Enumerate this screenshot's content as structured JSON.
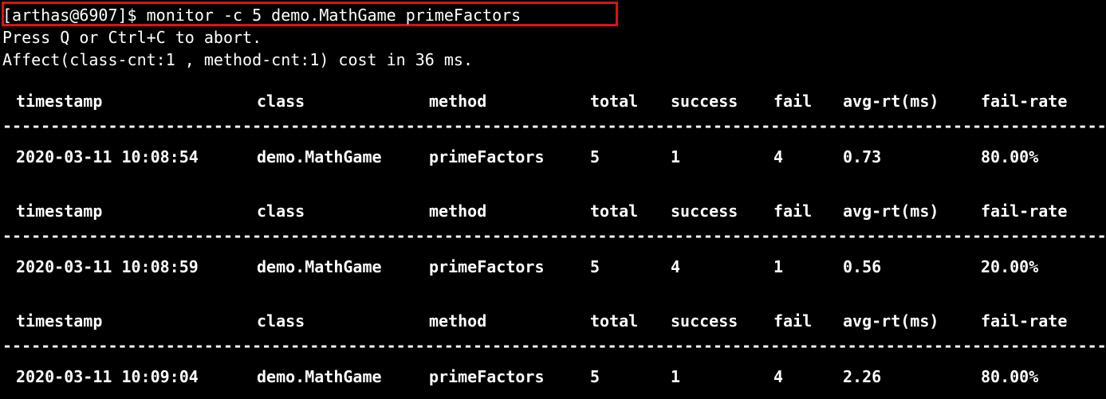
{
  "terminal": {
    "command_line": "[arthas@6907]$ monitor -c 5 demo.MathGame primeFactors",
    "abort_hint": "Press Q or Ctrl+C to abort.",
    "affect_line": "Affect(class-cnt:1 , method-cnt:1) cost in 36 ms.",
    "highlight_color": "#e01010"
  },
  "table": {
    "headers": [
      "timestamp",
      "class",
      "method",
      "total",
      "success",
      "fail",
      "avg-rt(ms)",
      "fail-rate"
    ],
    "separator": "------------------------------------------------------------------------------------------------------------------------------------------------",
    "blocks": [
      {
        "row": [
          "2020-03-11 10:08:54",
          "demo.MathGame",
          "primeFactors",
          "5",
          "1",
          "4",
          "0.73",
          "80.00%"
        ]
      },
      {
        "row": [
          "2020-03-11 10:08:59",
          "demo.MathGame",
          "primeFactors",
          "5",
          "4",
          "1",
          "0.56",
          "20.00%"
        ]
      },
      {
        "row": [
          "2020-03-11 10:09:04",
          "demo.MathGame",
          "primeFactors",
          "5",
          "1",
          "4",
          "2.26",
          "80.00%"
        ]
      }
    ]
  }
}
